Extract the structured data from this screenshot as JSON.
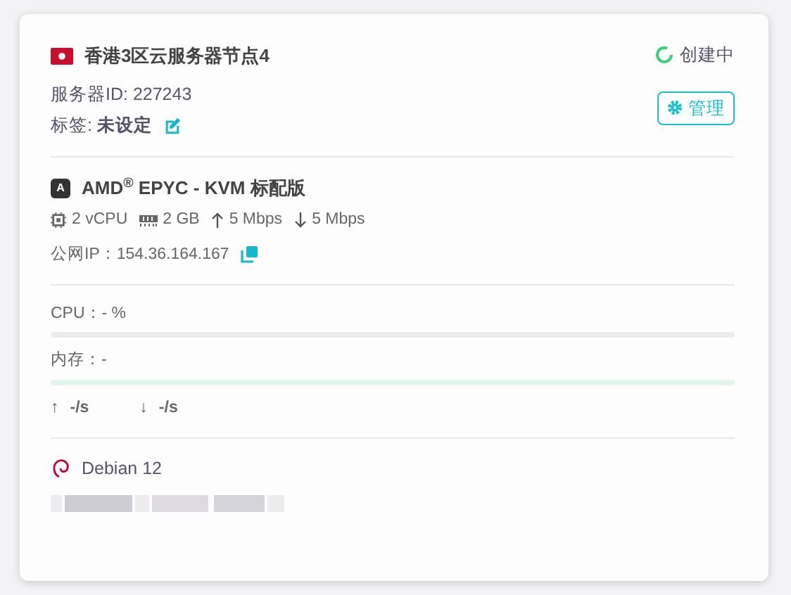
{
  "server": {
    "name": "香港3区云服务器节点4",
    "status": "创建中",
    "id_line": "服务器ID: 227243",
    "tag_label": "标签: ",
    "tag_value": "未设定",
    "manage_button": "管理"
  },
  "plan": {
    "logo": "A",
    "title": "AMD$^{®}$ EPYC - KVM 标配版",
    "specs": [
      {
        "kind": "cpu",
        "text": "2 vCPU"
      },
      {
        "kind": "ram",
        "text": "2 GB"
      },
      {
        "kind": "up",
        "text": "5 Mbps"
      },
      {
        "kind": "down",
        "text": "5 Mbps"
      }
    ],
    "ip_label": "公网IP：",
    "ip": "154.36.164.167"
  },
  "usage": [
    {
      "label": "CPU：- %",
      "level": 0,
      "color": "#ececec"
    },
    {
      "label": "内存：-",
      "level": 0,
      "color": "#e3f6ec"
    }
  ],
  "traffic": [
    {
      "arrow": "↑",
      "text": "-/s"
    },
    {
      "arrow": "↓",
      "text": "-/s"
    }
  ],
  "os": {
    "name": "Debian 12"
  }
}
